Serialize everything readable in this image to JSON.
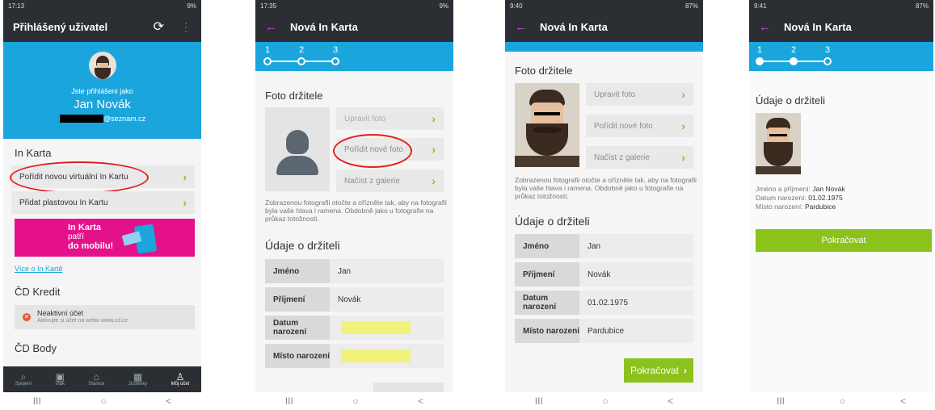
{
  "colors": {
    "accent": "#1ba5dd",
    "brand_pink": "#e5118a",
    "green": "#8bc21c",
    "dark": "#2b2f33",
    "annotation_red": "#e0201c",
    "highlight_yellow": "#f1f27a"
  },
  "nav_bar": {
    "recents": "III",
    "home": "○",
    "back": "<"
  },
  "s1": {
    "status_time": "17:13",
    "status_right": "9%",
    "title": "Přihlášený uživatel",
    "logged_as": "Jste přihlášeni jako",
    "user_name": "Jan Novák",
    "email_suffix": "@seznam.cz",
    "sec_inkarta": "In Karta",
    "btn_virtual": "Pořídit novou virtuální In Kartu",
    "btn_plastic": "Přidat plastovou In Kartu",
    "banner_l1": "In Karta",
    "banner_l2": "patří",
    "banner_l3": "do mobilu!",
    "more_link": "Více o In Kartě",
    "sec_kredit": "ČD Kredit",
    "inactive_title": "Neaktivní účet",
    "inactive_sub": "Aktivujte si účet na webu www.cd.cz",
    "sec_body": "ČD Body",
    "tabs": [
      "Spojení",
      "Vlak",
      "Stanice",
      "Jízdenky",
      "Můj účet"
    ]
  },
  "s2": {
    "status_time": "17:35",
    "status_right": "9%",
    "title": "Nová In Karta",
    "steps": [
      "1",
      "2",
      "3"
    ],
    "sec_photo": "Foto držitele",
    "btn_edit": "Upravit foto",
    "btn_new": "Pořídit nové foto",
    "btn_gallery": "Načíst z galerie",
    "note": "Zobrazenou fotografii otočte a ořízněte tak, aby na fotografii byla vaše hlava i ramena. Obdobně jako u fotografie na průkaz totožnosti.",
    "sec_data": "Údaje o držiteli",
    "f_name": "Jméno",
    "v_name": "Jan",
    "f_surname": "Příjmení",
    "v_surname": "Novák",
    "f_birth": "Datum narození",
    "f_place": "Místo narození"
  },
  "s3": {
    "status_time": "9:40",
    "status_right": "87%",
    "title": "Nová In Karta",
    "sec_photo": "Foto držitele",
    "btn_edit": "Upravit foto",
    "btn_new": "Pořídit nové foto",
    "btn_gallery": "Načíst z galerie",
    "note": "Zobrazenou fotografii otočte a ořízněte tak, aby na fotografii byla vaše hlava i ramena. Obdobně jako u fotografie na průkaz totožnosti.",
    "sec_data": "Údaje o držiteli",
    "f_name": "Jméno",
    "v_name": "Jan",
    "f_surname": "Příjmení",
    "v_surname": "Novák",
    "f_birth": "Datum narození",
    "v_birth": "01.02.1975",
    "f_place": "Místo narození",
    "v_place": "Pardubice",
    "btn_continue": "Pokračovat"
  },
  "s4": {
    "status_time": "9:41",
    "status_right": "87%",
    "title": "Nová In Karta",
    "steps": [
      "1",
      "2",
      "3"
    ],
    "sec_data": "Údaje o držiteli",
    "l_name": "Jméno a příjmení:",
    "v_name": "Jan Novák",
    "l_birth": "Datum narození:",
    "v_birth": "01.02.1975",
    "l_place": "Místo narození:",
    "v_place": "Pardubice",
    "btn_continue": "Pokračovat"
  }
}
